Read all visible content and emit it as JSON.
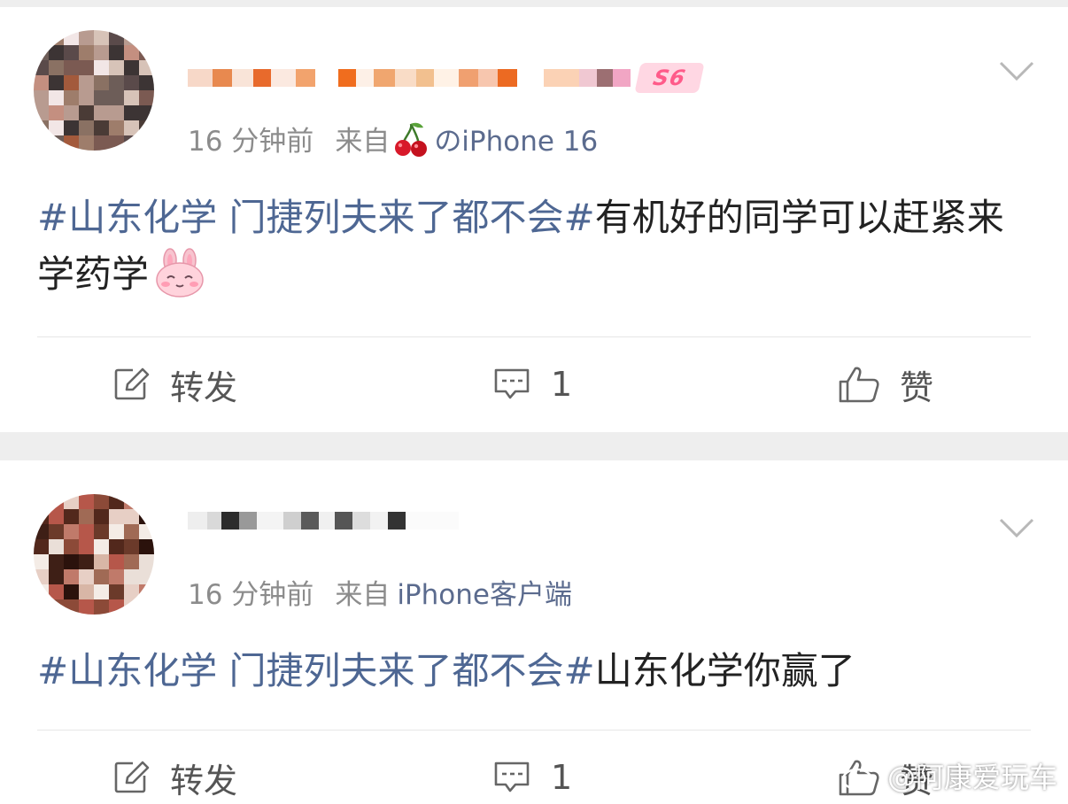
{
  "posts": [
    {
      "badge": "S6",
      "time": "16 分钟前",
      "from_label": "来自",
      "device": "のiPhone 16",
      "topic": "#山东化学 门捷列夫来了都不会#",
      "text": "有机好的同学可以赶紧来学药学",
      "emoji_icon": "bunny-emoji-icon",
      "actions": {
        "repost": "转发",
        "comments": "1",
        "like": "赞"
      }
    },
    {
      "time": "16 分钟前",
      "from_label": "来自",
      "device": "iPhone客户端",
      "topic": "#山东化学 门捷列夫来了都不会#",
      "text": "山东化学你赢了",
      "actions": {
        "repost": "转发",
        "comments": "1",
        "like": "赞"
      }
    }
  ],
  "watermark": "@阿康爱玩车",
  "colors": {
    "topic": "#4e6793",
    "meta": "#8c8c8c",
    "device": "#5b6b8e",
    "badge": "#ff5b8a"
  }
}
